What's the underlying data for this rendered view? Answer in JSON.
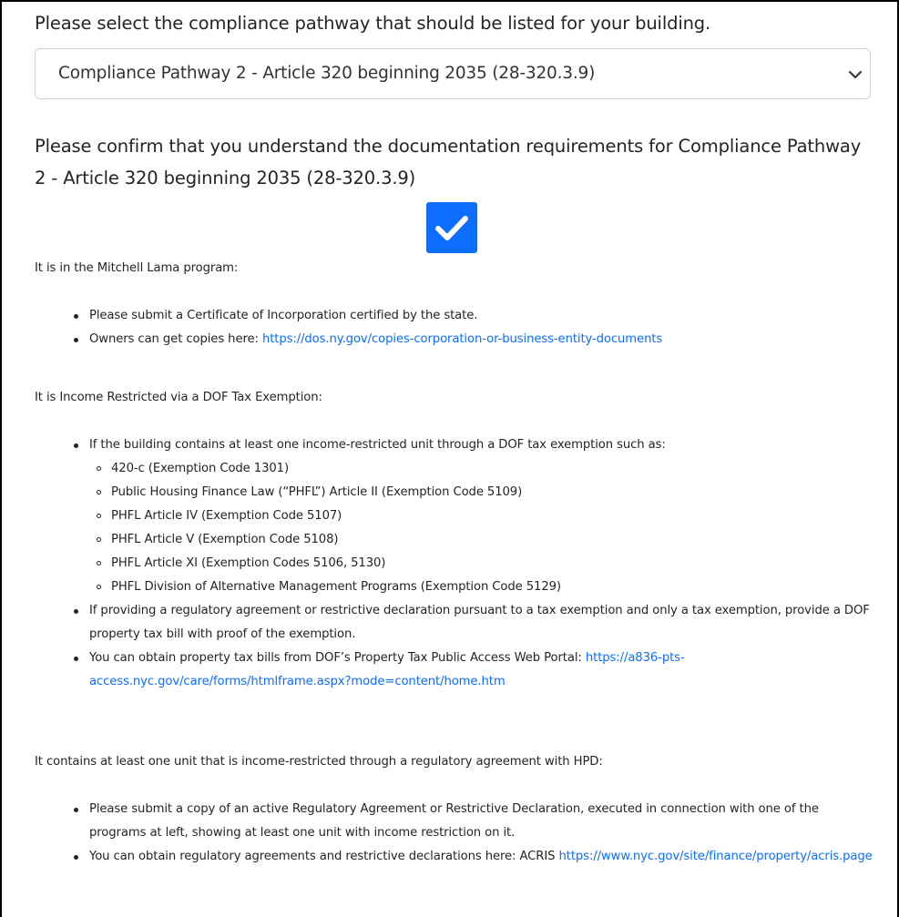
{
  "pathway_question": "Please select the compliance pathway that should be listed for your building.",
  "pathway_select": {
    "selected": "Compliance Pathway 2 - Article 320 beginning 2035 (28-320.3.9)"
  },
  "confirm_question": "Please confirm that you understand the documentation requirements for Compliance Pathway 2 - Article 320 beginning 2035 (28-320.3.9)",
  "confirm_checkbox": {
    "checked": true,
    "color": "#0d6efd"
  },
  "sections": {
    "mitchell_lama": {
      "heading": "It is in the Mitchell Lama program:",
      "item1": "Please submit a Certificate of Incorporation certified by the state.",
      "item2_prefix": "Owners can get copies here: ",
      "item2_link": "https://dos.ny.gov/copies-corporation-or-business-entity-documents"
    },
    "dof_tax": {
      "heading": "It is Income Restricted via a DOF Tax Exemption:",
      "item1": "If the building contains at least one income-restricted unit through a DOF tax exemption such as:",
      "subitems": [
        "420-c (Exemption Code 1301)",
        "Public Housing Finance Law (“PHFL”) Article II (Exemption Code 5109)",
        "PHFL Article IV (Exemption Code 5107)",
        "PHFL Article V (Exemption Code 5108)",
        "PHFL Article XI (Exemption Codes 5106, 5130)",
        "PHFL Division of Alternative Management Programs (Exemption Code 5129)"
      ],
      "item2": "If providing a regulatory agreement or restrictive declaration pursuant to a tax exemption and only a tax exemption, provide a DOF property tax bill with proof of the exemption.",
      "item3_prefix": "You can obtain property tax bills from DOF’s Property Tax Public Access Web Portal: ",
      "item3_link": "https://a836-pts-access.nyc.gov/care/forms/htmlframe.aspx?mode=content/home.htm"
    },
    "hpd": {
      "heading": "It contains at least one unit that is income-restricted through a regulatory agreement with HPD:",
      "item1": "Please submit a copy of an active Regulatory Agreement or Restrictive Declaration, executed in connection with one of the programs at left, showing at least one unit with income restriction on it.",
      "item2_prefix": "You can obtain regulatory agreements and restrictive declarations here: ACRIS ",
      "item2_link": "https://www.nyc.gov/site/finance/property/acris.page"
    }
  }
}
